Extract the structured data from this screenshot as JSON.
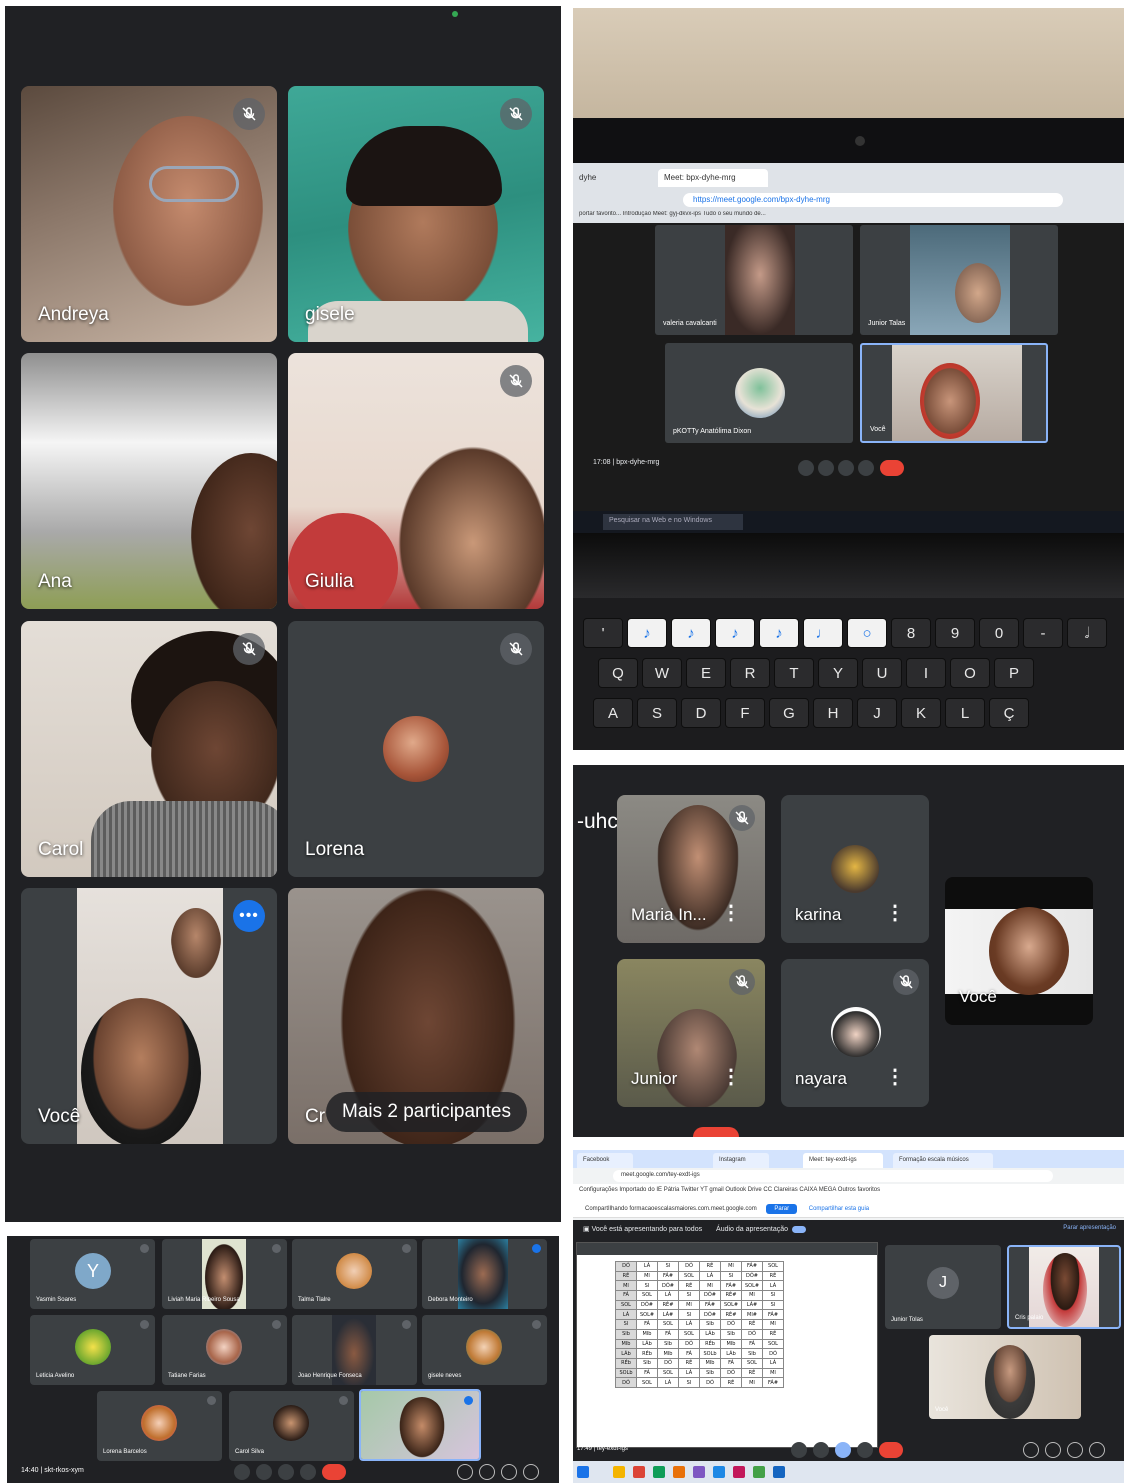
{
  "panel1": {
    "participants": [
      {
        "name": "Andreya",
        "muted": true
      },
      {
        "name": "gisele",
        "muted": true
      },
      {
        "name": "Ana",
        "muted": false
      },
      {
        "name": "Giulia",
        "muted": true
      },
      {
        "name": "Carol",
        "muted": true
      },
      {
        "name": "Lorena",
        "muted": true
      },
      {
        "name": "Você",
        "muted": false
      },
      {
        "name": "Cr",
        "muted": false
      }
    ],
    "more_participants": "Mais 2 participantes"
  },
  "panel2": {
    "tab1": "dyhe",
    "tab2": "Meet: bpx-dyhe-mrg",
    "url": "https://meet.google.com/bpx-dyhe-mrg",
    "bookmarks": "portar favorito... Introdução Meet: gyj-dkvx-ips Tudo o seu mundo de...",
    "tiles": [
      {
        "name": "valeria cavalcanti"
      },
      {
        "name": "Junior Talas"
      },
      {
        "name": "pKOTTy Anatólima Dixon"
      },
      {
        "name": "Você"
      }
    ],
    "meeting_code": "17:08 | bpx-dyhe-mrg",
    "taskbar_search": "Pesquisar na Web e no Windows",
    "keys_row_number": [
      "'",
      "♪",
      "♪",
      "♪",
      "♪",
      "♩",
      "○",
      "8",
      "9",
      "0",
      "-",
      "𝅗𝅥"
    ],
    "keys_row_q": [
      "Q",
      "W",
      "E",
      "R",
      "T",
      "Y",
      "U",
      "I",
      "O",
      "P"
    ],
    "keys_row_a": [
      "A",
      "S",
      "D",
      "F",
      "G",
      "H",
      "J",
      "K",
      "L",
      "Ç"
    ]
  },
  "panel3": {
    "meeting_code": "-uhc",
    "participants": [
      {
        "name": "Maria In..."
      },
      {
        "name": "karina"
      },
      {
        "name": "Junior"
      },
      {
        "name": "nayara"
      }
    ],
    "self_name": "Você"
  },
  "panel4": {
    "participants": [
      {
        "name": "Yasmin Soares",
        "initial": "Y"
      },
      {
        "name": "Liviah Maria Ribeiro Sousa"
      },
      {
        "name": "Talma Tlalre"
      },
      {
        "name": "Debora Monteiro"
      },
      {
        "name": "Leticia Avelino"
      },
      {
        "name": "Tatiane Farias"
      },
      {
        "name": "Joao Henrique Fonseca"
      },
      {
        "name": "gisele neves"
      },
      {
        "name": "Lorena Barcelos"
      },
      {
        "name": "Carol Silva"
      },
      {
        "name": ""
      }
    ],
    "meeting_code": "14:40 | skt-rkos-xym"
  },
  "panel5": {
    "tabs": [
      "Facebook",
      "Instagram",
      "Meet: tey-exdt-igs",
      "Formação escala músicos"
    ],
    "url": "meet.google.com/tey-exdt-igs",
    "bookmarks": "Configurações  Importado do IE  Pátria  Twitter  YT  gmail  Outlook  Drive  CC  Clareiras  CAIXA  MEGA  Outros favoritos",
    "sharing_text": "CompartIlhando formacaoescalasmaiores.com.meet.google.com",
    "stop_sharing": "Parar",
    "hide": "Compartilhar esta guia",
    "presenting_text": "Você está apresentando para todos",
    "audio_label": "Áudio da apresentação",
    "stop_presenting": "Parar apresentação",
    "participants": [
      {
        "name": "Junior Tolas",
        "initial": "J"
      },
      {
        "name": "Cris palaio"
      },
      {
        "name": "Você"
      }
    ],
    "meeting_code": "17:49 | tey-exdt-igs",
    "solfa_rows": [
      [
        "DÓ",
        "LÁ",
        "SI",
        "DÓ",
        "RÉ",
        "MI",
        "FÁ#",
        "SOL"
      ],
      [
        "RÉ",
        "MI",
        "FÁ#",
        "SOL",
        "LÁ",
        "SI",
        "DÓ#",
        "RÉ"
      ],
      [
        "MI",
        "SI",
        "DÓ#",
        "RÉ",
        "MI",
        "FÁ#",
        "SOL#",
        "LÁ"
      ],
      [
        "FÁ",
        "SOL",
        "LÁ",
        "SI",
        "DÓ#",
        "RÉ#",
        "MI",
        "SI"
      ],
      [
        "SOL",
        "DÓ#",
        "RÉ#",
        "MI",
        "FÁ#",
        "SOL#",
        "LÁ#",
        "SI"
      ],
      [
        "LÁ",
        "SOL#",
        "LÁ#",
        "SI",
        "DÓ#",
        "RÉ#",
        "MI#",
        "FÁ#"
      ],
      [
        "SI",
        "FÁ",
        "SOL",
        "LÁ",
        "SIb",
        "DÓ",
        "RÉ",
        "MI"
      ],
      [
        "SIb",
        "MIb",
        "FÁ",
        "SOL",
        "LÁb",
        "SIb",
        "DÓ",
        "RÉ"
      ],
      [
        "MIb",
        "LÁb",
        "SIb",
        "DÓ",
        "RÉb",
        "MIb",
        "FÁ",
        "SOL"
      ],
      [
        "LÁb",
        "RÉb",
        "MIb",
        "FÁ",
        "SOLb",
        "LÁb",
        "SIb",
        "DÓ"
      ],
      [
        "RÉb",
        "SIb",
        "DÓ",
        "RÉ",
        "MIb",
        "FÁ",
        "SOL",
        "LÁ"
      ],
      [
        "SOLb",
        "FÁ",
        "SOL",
        "LÁ",
        "SIb",
        "DÓ",
        "RÉ",
        "MI"
      ],
      [
        "DÓ",
        "SOL",
        "LÁ",
        "SI",
        "DÓ",
        "RÉ",
        "MI",
        "FÁ#"
      ]
    ]
  },
  "colors": {
    "meet_bg": "#202124",
    "tile_bg": "#3c4043",
    "accent": "#1a73e8",
    "end_call": "#ea4335"
  }
}
